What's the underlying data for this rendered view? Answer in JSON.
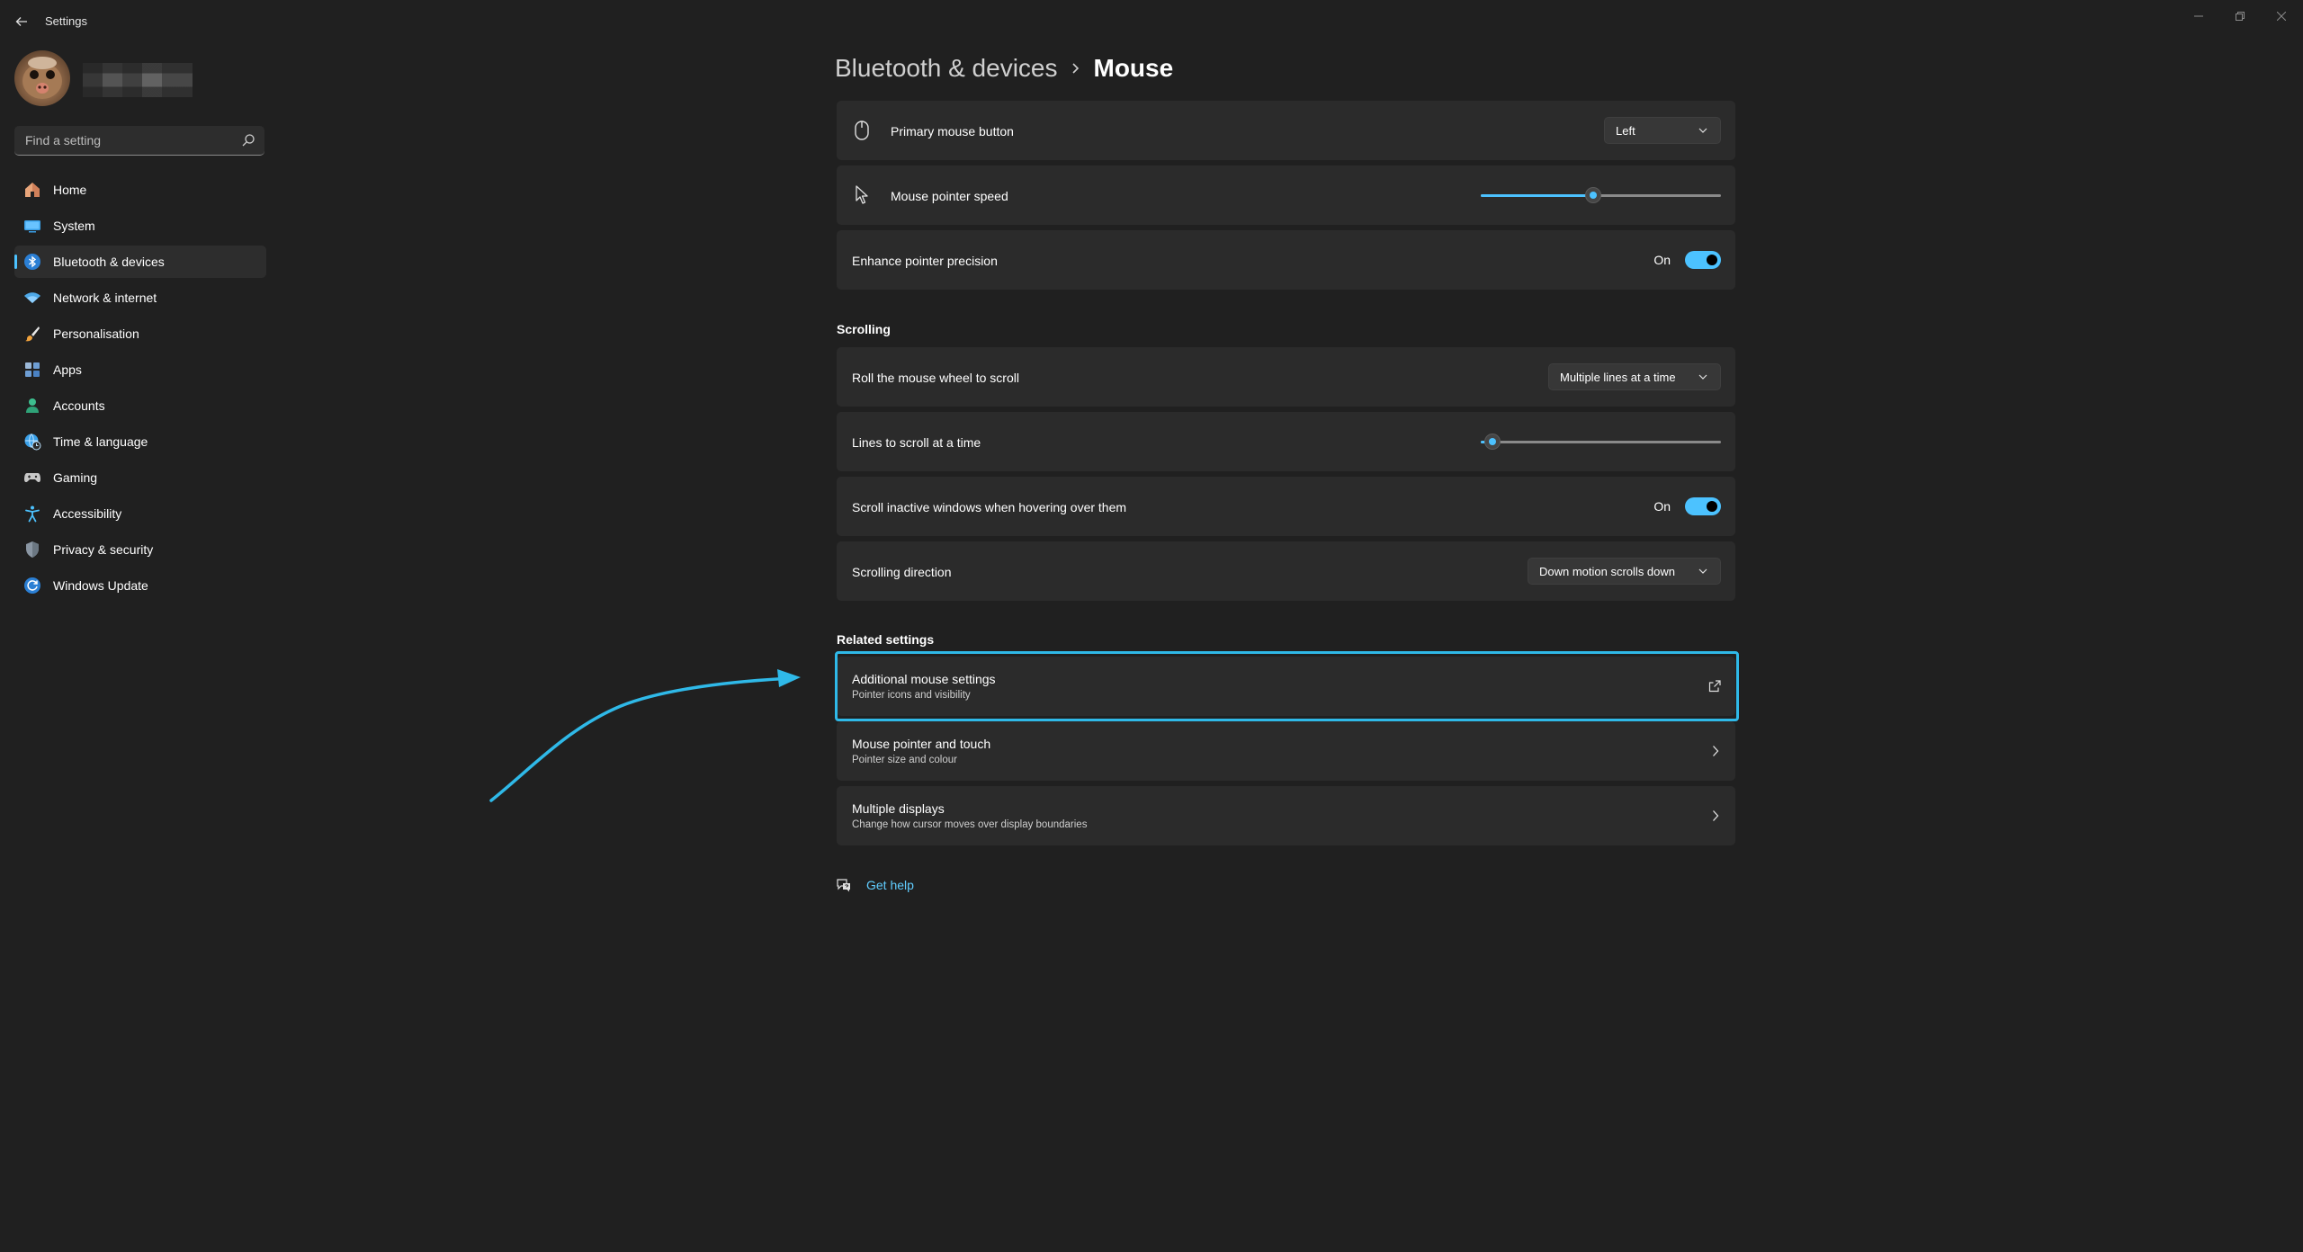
{
  "window": {
    "title": "Settings"
  },
  "search": {
    "placeholder": "Find a setting"
  },
  "sidebar": {
    "items": [
      {
        "label": "Home",
        "icon": "home-icon",
        "active": false
      },
      {
        "label": "System",
        "icon": "system-icon",
        "active": false
      },
      {
        "label": "Bluetooth & devices",
        "icon": "bluetooth-icon",
        "active": true
      },
      {
        "label": "Network & internet",
        "icon": "wifi-icon",
        "active": false
      },
      {
        "label": "Personalisation",
        "icon": "brush-icon",
        "active": false
      },
      {
        "label": "Apps",
        "icon": "apps-icon",
        "active": false
      },
      {
        "label": "Accounts",
        "icon": "account-icon",
        "active": false
      },
      {
        "label": "Time & language",
        "icon": "globe-clock-icon",
        "active": false
      },
      {
        "label": "Gaming",
        "icon": "gamepad-icon",
        "active": false
      },
      {
        "label": "Accessibility",
        "icon": "accessibility-icon",
        "active": false
      },
      {
        "label": "Privacy & security",
        "icon": "shield-icon",
        "active": false
      },
      {
        "label": "Windows Update",
        "icon": "update-icon",
        "active": false
      }
    ]
  },
  "breadcrumb": {
    "parent": "Bluetooth & devices",
    "current": "Mouse"
  },
  "mouse": {
    "primary_button": {
      "label": "Primary mouse button",
      "value": "Left"
    },
    "pointer_speed": {
      "label": "Mouse pointer speed",
      "level": 0.47
    },
    "enhance_precision": {
      "label": "Enhance pointer precision",
      "state": "On"
    }
  },
  "scrolling": {
    "title": "Scrolling",
    "roll_wheel": {
      "label": "Roll the mouse wheel to scroll",
      "value": "Multiple lines at a time"
    },
    "lines": {
      "label": "Lines to scroll at a time",
      "level": 0.05
    },
    "inactive_windows": {
      "label": "Scroll inactive windows when hovering over them",
      "state": "On"
    },
    "direction": {
      "label": "Scrolling direction",
      "value": "Down motion scrolls down"
    }
  },
  "related": {
    "title": "Related settings",
    "items": [
      {
        "title": "Additional mouse settings",
        "subtitle": "Pointer icons and visibility"
      },
      {
        "title": "Mouse pointer and touch",
        "subtitle": "Pointer size and colour"
      },
      {
        "title": "Multiple displays",
        "subtitle": "Change how cursor moves over display boundaries"
      }
    ]
  },
  "help": {
    "label": "Get help"
  },
  "colors": {
    "background": "#202020",
    "card": "#2b2b2b",
    "accent": "#4cc2ff",
    "highlight_border": "#2fb9e8",
    "annotation_arrow": "#2fb9e8"
  }
}
